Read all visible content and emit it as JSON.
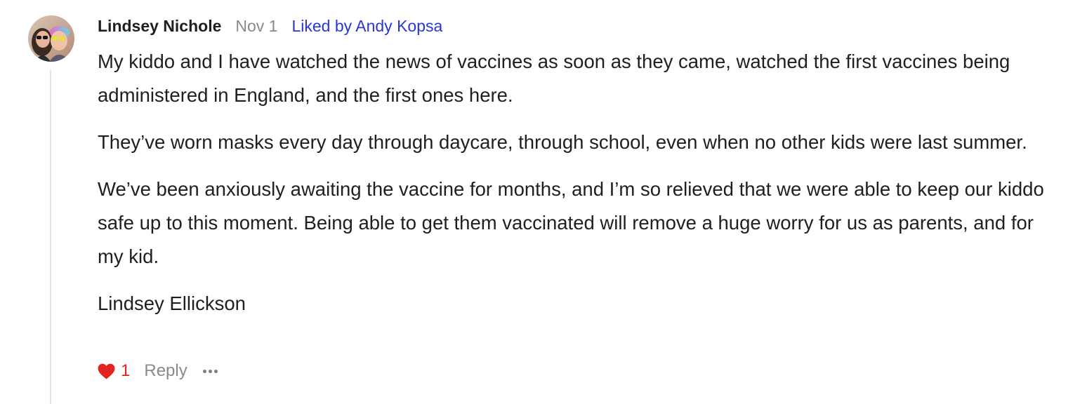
{
  "comment": {
    "author": "Lindsey Nichole",
    "date": "Nov 1",
    "liked_by": "Liked by Andy Kopsa",
    "paragraphs": [
      "My kiddo and I have watched the news of vaccines as soon as they came, watched the first vaccines being administered in England, and the first ones here.",
      "They’ve worn masks every day through daycare, through school, even when no other kids were last summer.",
      "We’ve been anxiously awaiting the vaccine for months, and I’m so relieved that we were able to keep our kiddo safe up to this moment. Being able to get them vaccinated will remove a huge worry for us as parents, and for my kid.",
      "Lindsey Ellickson"
    ],
    "like_count": "1",
    "reply_label": "Reply",
    "icons": {
      "avatar": "avatar",
      "like": "heart-icon",
      "more": "more-options-icon"
    },
    "colors": {
      "text": "#1f1f1f",
      "muted": "#8a8a8a",
      "link": "#2a36d6",
      "heart": "#e0241f",
      "thread_line": "#e4e4e4"
    }
  }
}
